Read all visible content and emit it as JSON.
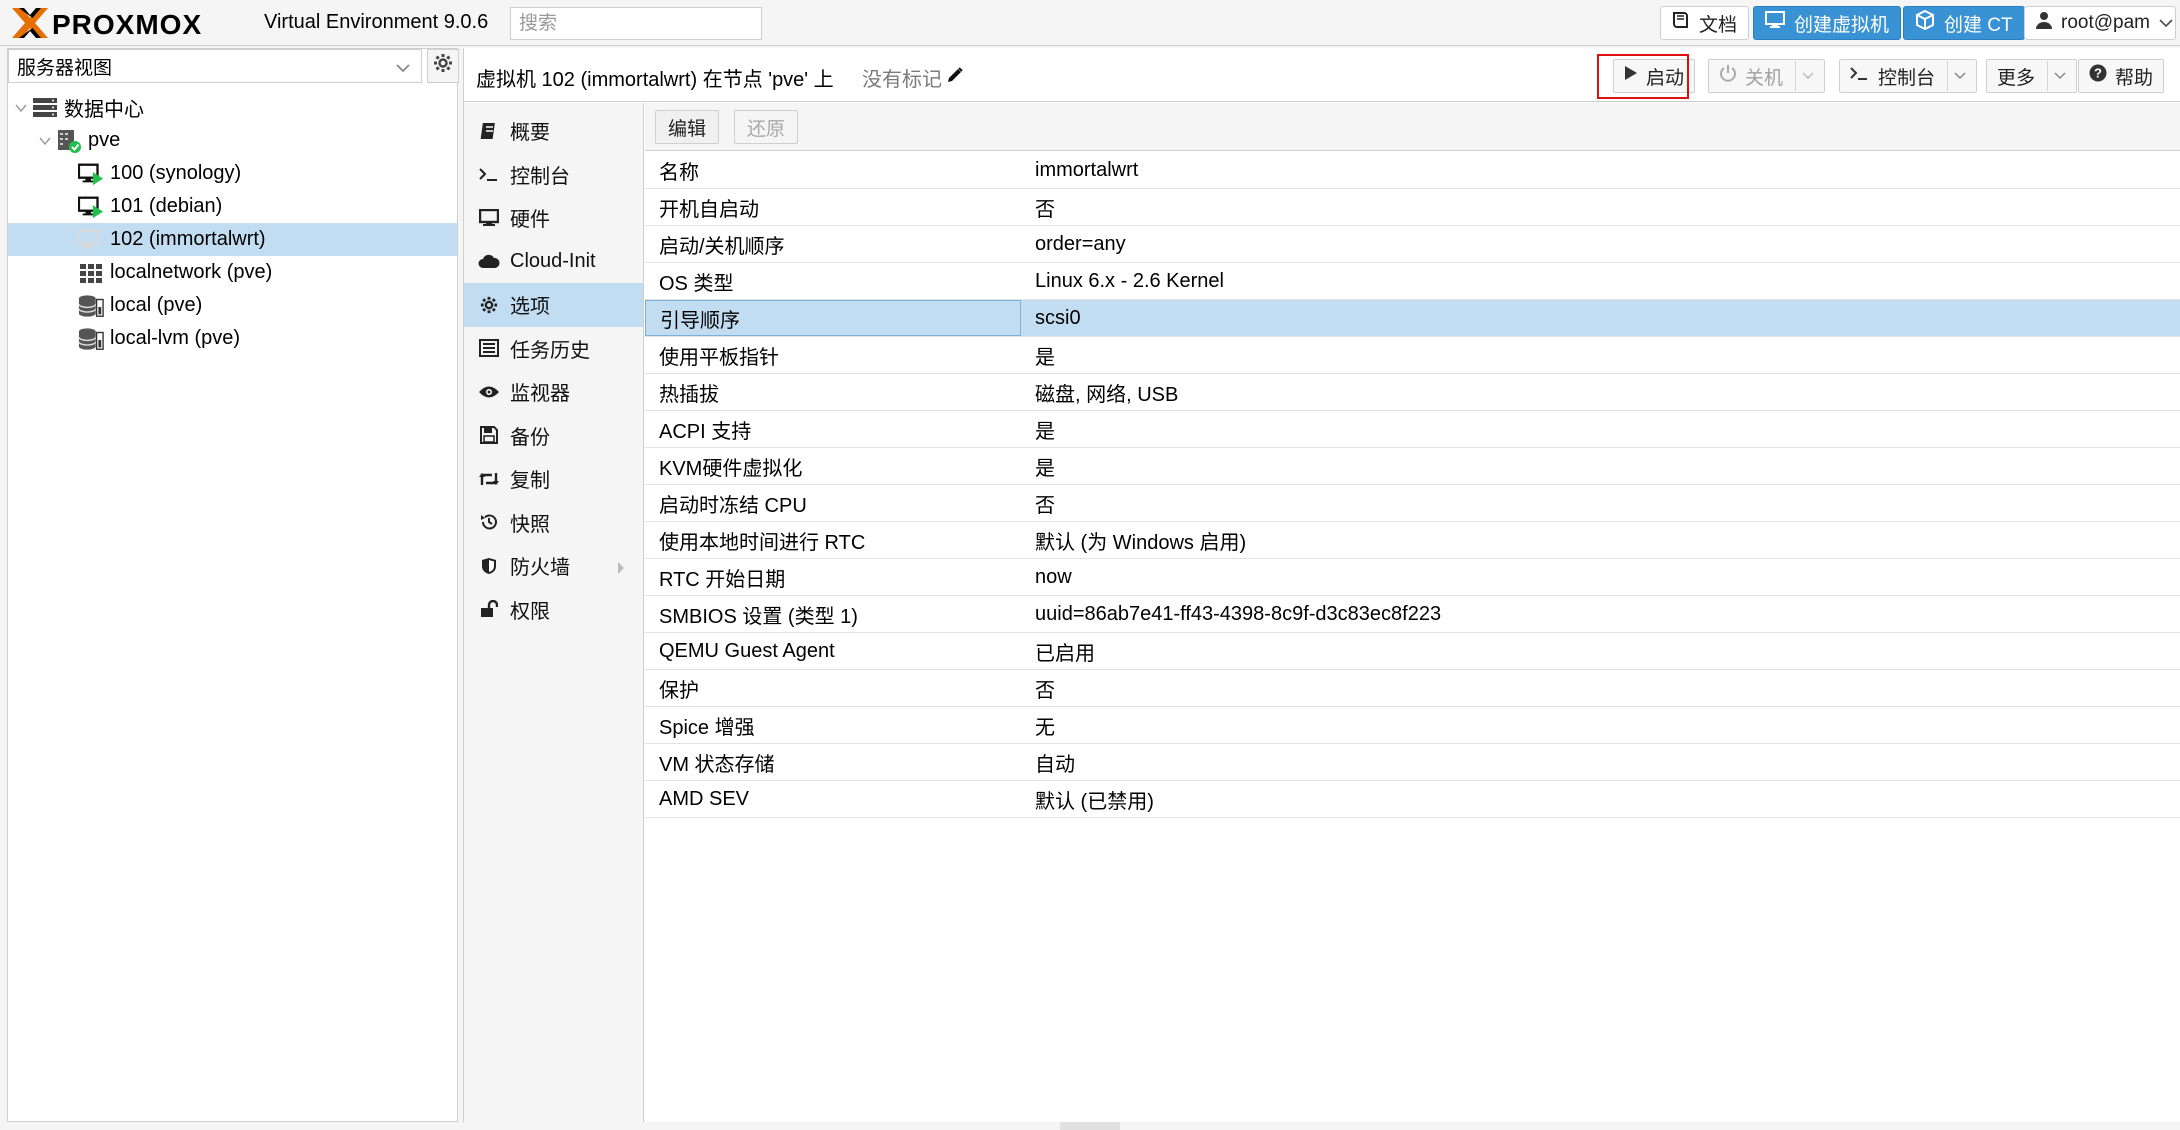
{
  "app": {
    "logo_text": "PROXMOX",
    "version_label": "Virtual Environment 9.0.6",
    "search_placeholder": "搜索"
  },
  "topbar": {
    "docs_label": "文档",
    "create_vm_label": "创建虚拟机",
    "create_ct_label": "创建 CT",
    "user_label": "root@pam"
  },
  "tree": {
    "view_selector": "服务器视图",
    "nodes": [
      {
        "label": "数据中心",
        "icon": "datacenter-icon"
      },
      {
        "label": "pve",
        "icon": "node-online-icon"
      },
      {
        "label": "100 (synology)",
        "icon": "vm-running-icon"
      },
      {
        "label": "101 (debian)",
        "icon": "vm-running-icon"
      },
      {
        "label": "102 (immortalwrt)",
        "icon": "vm-stopped-icon"
      },
      {
        "label": "localnetwork (pve)",
        "icon": "network-icon"
      },
      {
        "label": "local (pve)",
        "icon": "storage-icon"
      },
      {
        "label": "local-lvm (pve)",
        "icon": "storage-icon"
      }
    ]
  },
  "header": {
    "title": "虚拟机 102 (immortalwrt) 在节点 'pve' 上",
    "tags_label": "没有标记",
    "start_label": "启动",
    "shutdown_label": "关机",
    "console_label": "控制台",
    "more_label": "更多",
    "help_label": "帮助"
  },
  "subnav": {
    "items": [
      {
        "label": "概要",
        "icon": "summary-icon"
      },
      {
        "label": "控制台",
        "icon": "console-icon"
      },
      {
        "label": "硬件",
        "icon": "hardware-icon"
      },
      {
        "label": "Cloud-Init",
        "icon": "cloud-icon"
      },
      {
        "label": "选项",
        "icon": "gear-icon"
      },
      {
        "label": "任务历史",
        "icon": "task-history-icon"
      },
      {
        "label": "监视器",
        "icon": "eye-icon"
      },
      {
        "label": "备份",
        "icon": "floppy-icon"
      },
      {
        "label": "复制",
        "icon": "retweet-icon"
      },
      {
        "label": "快照",
        "icon": "history-icon"
      },
      {
        "label": "防火墙",
        "icon": "shield-icon"
      },
      {
        "label": "权限",
        "icon": "unlock-icon"
      }
    ]
  },
  "options": {
    "edit_label": "编辑",
    "revert_label": "还原",
    "rows": [
      {
        "key": "名称",
        "value": "immortalwrt"
      },
      {
        "key": "开机自启动",
        "value": "否"
      },
      {
        "key": "启动/关机顺序",
        "value": "order=any"
      },
      {
        "key": "OS 类型",
        "value": "Linux 6.x - 2.6 Kernel"
      },
      {
        "key": "引导顺序",
        "value": "scsi0"
      },
      {
        "key": "使用平板指针",
        "value": "是"
      },
      {
        "key": "热插拔",
        "value": "磁盘, 网络, USB"
      },
      {
        "key": "ACPI 支持",
        "value": "是"
      },
      {
        "key": "KVM硬件虚拟化",
        "value": "是"
      },
      {
        "key": "启动时冻结 CPU",
        "value": "否"
      },
      {
        "key": "使用本地时间进行 RTC",
        "value": "默认 (为 Windows 启用)"
      },
      {
        "key": "RTC 开始日期",
        "value": "now"
      },
      {
        "key": "SMBIOS 设置 (类型 1)",
        "value": "uuid=86ab7e41-ff43-4398-8c9f-d3c83ec8f223"
      },
      {
        "key": "QEMU Guest Agent",
        "value": "已启用"
      },
      {
        "key": "保护",
        "value": "否"
      },
      {
        "key": "Spice 增强",
        "value": "无"
      },
      {
        "key": "VM 状态存储",
        "value": "自动"
      },
      {
        "key": "AMD SEV",
        "value": "默认 (已禁用)"
      }
    ]
  },
  "colors": {
    "accent_blue": "#3892d4",
    "selected_row": "#c2ddf2",
    "logo_orange": "#e57000",
    "running_green": "#21bf4b",
    "highlight_red": "#e01010"
  }
}
